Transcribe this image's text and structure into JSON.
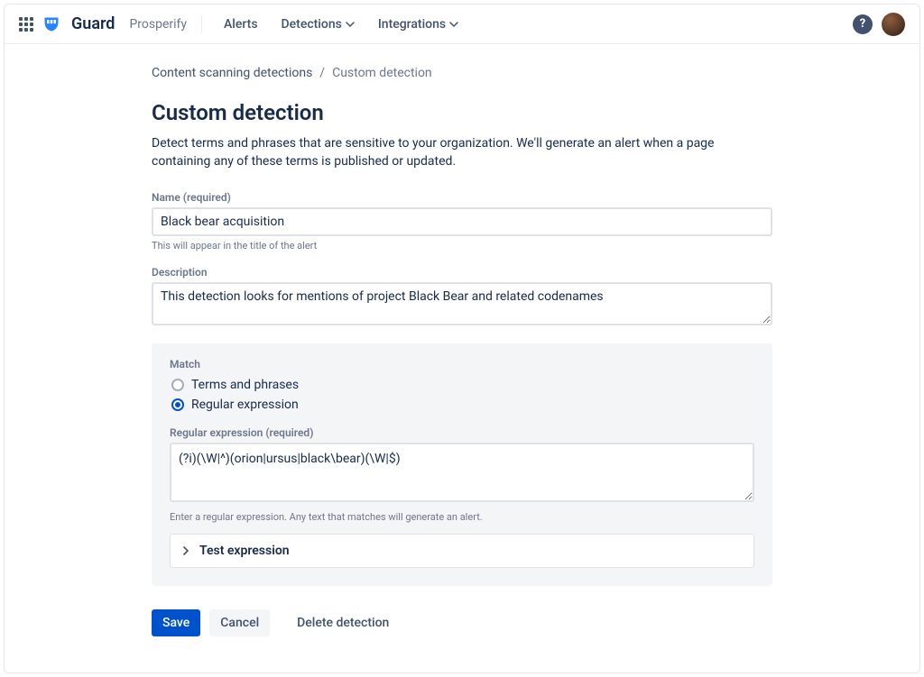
{
  "header": {
    "product": "Guard",
    "org": "Prosperify",
    "nav": {
      "alerts": "Alerts",
      "detections": "Detections",
      "integrations": "Integrations"
    }
  },
  "breadcrumb": {
    "parent": "Content scanning detections",
    "current": "Custom detection"
  },
  "page": {
    "title": "Custom detection",
    "subtitle": "Detect terms and phrases that are sensitive to your organization. We'll generate an alert when a page containing any of these terms is published or updated."
  },
  "form": {
    "name_label": "Name (required)",
    "name_value": "Black bear acquisition",
    "name_help": "This will appear in the title of the alert",
    "desc_label": "Description",
    "desc_value": "This detection looks for mentions of project Black Bear and related codenames"
  },
  "match": {
    "heading": "Match",
    "option_terms": "Terms and phrases",
    "option_regex": "Regular expression",
    "regex_label": "Regular expression (required)",
    "regex_value": "(?i)(\\W|^)(orion|ursus|black\\bear)(\\W|$)",
    "regex_help": "Enter a regular expression. Any text that matches will generate an alert.",
    "test_label": "Test expression"
  },
  "actions": {
    "save": "Save",
    "cancel": "Cancel",
    "delete": "Delete detection"
  }
}
